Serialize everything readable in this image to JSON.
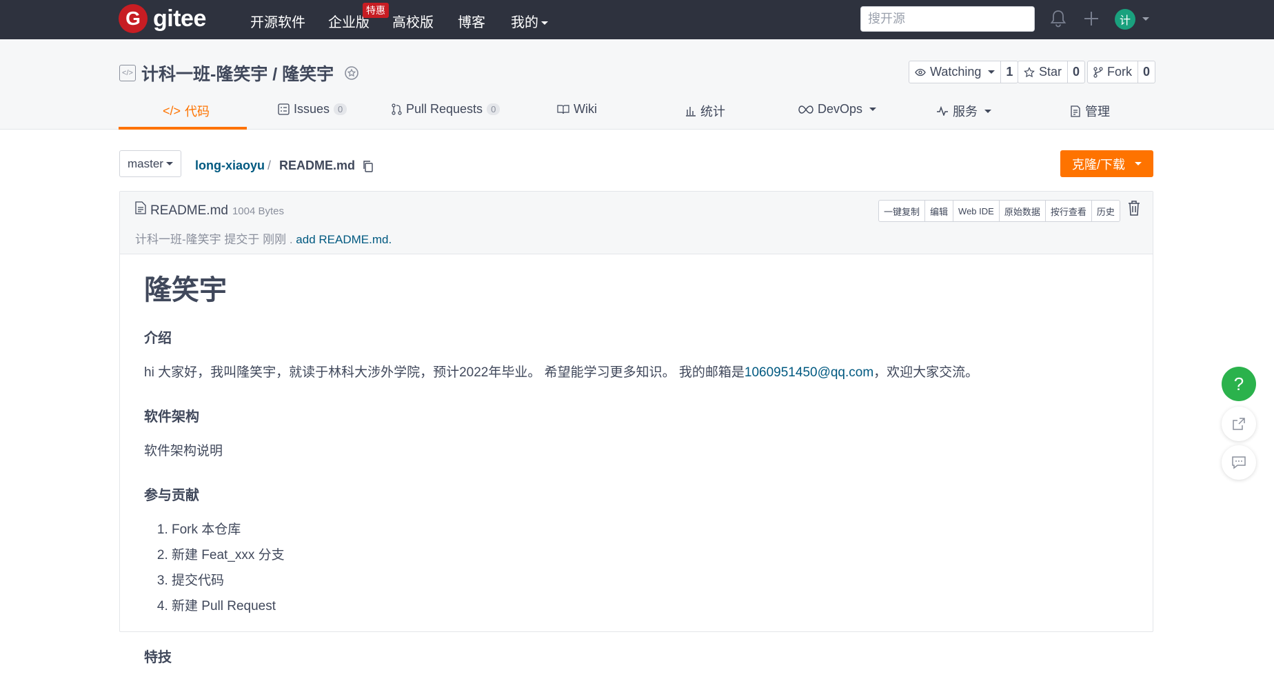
{
  "topbar": {
    "logo_letter": "G",
    "logo_text": "gitee",
    "nav": [
      "开源软件",
      "企业版",
      "高校版",
      "博客",
      "我的"
    ],
    "hot_badge": "特惠",
    "search_placeholder": "搜开源",
    "avatar_initial": "计"
  },
  "repo": {
    "title": "计科一班-隆笑宇 / 隆笑宇",
    "watching_label": "Watching",
    "watching_count": "1",
    "star_label": "Star",
    "star_count": "0",
    "fork_label": "Fork",
    "fork_count": "0"
  },
  "tabs": [
    {
      "label": "代码",
      "count": null
    },
    {
      "label": "Issues",
      "count": "0"
    },
    {
      "label": "Pull Requests",
      "count": "0"
    },
    {
      "label": "Wiki",
      "count": null
    },
    {
      "label": "统计",
      "count": null
    },
    {
      "label": "DevOps",
      "count": null
    },
    {
      "label": "服务",
      "count": null
    },
    {
      "label": "管理",
      "count": null
    }
  ],
  "branch": "master",
  "breadcrumb": {
    "dir": "long-xiaoyu",
    "sep": "/",
    "file": "README.md"
  },
  "clone_label": "克隆/下载",
  "file": {
    "name": "README.md",
    "size": "1004 Bytes",
    "commit_author": "计科一班-隆笑宇 提交于 刚刚 .",
    "commit_msg": "add README.md.",
    "actions": [
      "一键复制",
      "编辑",
      "Web IDE",
      "原始数据",
      "按行查看",
      "历史"
    ]
  },
  "readme": {
    "title": "隆笑宇",
    "h_intro": "介绍",
    "intro_pre": "hi 大家好，我叫隆笑宇，就读于林科大涉外学院，预计2022年毕业。 希望能学习更多知识。 我的邮箱是",
    "email": "1060951450@qq.com",
    "intro_post": "，欢迎大家交流。",
    "h_arch": "软件架构",
    "arch_text": "软件架构说明",
    "h_contrib": "参与贡献",
    "steps": [
      "Fork 本仓库",
      "新建 Feat_xxx 分支",
      "提交代码",
      "新建 Pull Request"
    ],
    "h_next": "特技"
  },
  "float": {
    "help": "?"
  }
}
